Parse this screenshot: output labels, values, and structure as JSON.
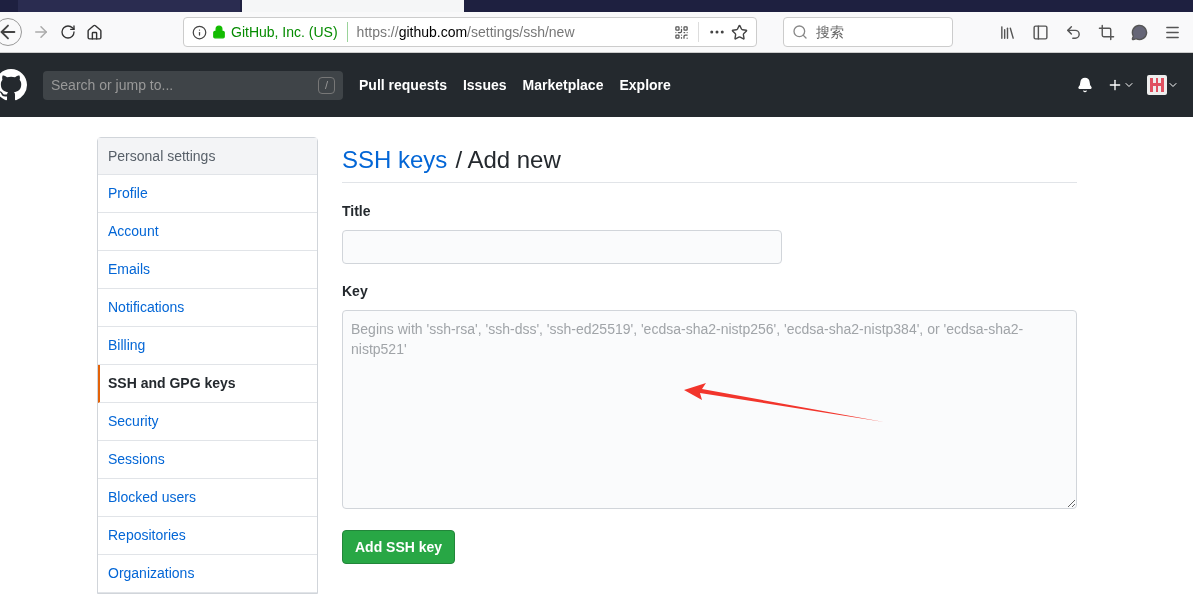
{
  "browser": {
    "tabs": [
      {
        "selected": false
      },
      {
        "selected": true
      }
    ],
    "identity": "GitHub, Inc. (US)",
    "url_scheme": "https://",
    "url_host": "github.com",
    "url_path": "/settings/ssh/new",
    "search_placeholder": "搜索"
  },
  "header": {
    "search_placeholder": "Search or jump to...",
    "slash_key": "/",
    "nav": [
      "Pull requests",
      "Issues",
      "Marketplace",
      "Explore"
    ]
  },
  "sidebar": {
    "title": "Personal settings",
    "items": [
      {
        "label": "Profile",
        "selected": false
      },
      {
        "label": "Account",
        "selected": false
      },
      {
        "label": "Emails",
        "selected": false
      },
      {
        "label": "Notifications",
        "selected": false
      },
      {
        "label": "Billing",
        "selected": false
      },
      {
        "label": "SSH and GPG keys",
        "selected": true
      },
      {
        "label": "Security",
        "selected": false
      },
      {
        "label": "Sessions",
        "selected": false
      },
      {
        "label": "Blocked users",
        "selected": false
      },
      {
        "label": "Repositories",
        "selected": false
      },
      {
        "label": "Organizations",
        "selected": false
      }
    ]
  },
  "form": {
    "breadcrumb_link": "SSH keys",
    "breadcrumb_rest": "/ Add new",
    "title_label": "Title",
    "key_label": "Key",
    "key_placeholder": "Begins with 'ssh-rsa', 'ssh-dss', 'ssh-ed25519', 'ecdsa-sha2-nistp256', 'ecdsa-sha2-nistp384', or 'ecdsa-sha2-nistp521'",
    "submit": "Add SSH key"
  }
}
